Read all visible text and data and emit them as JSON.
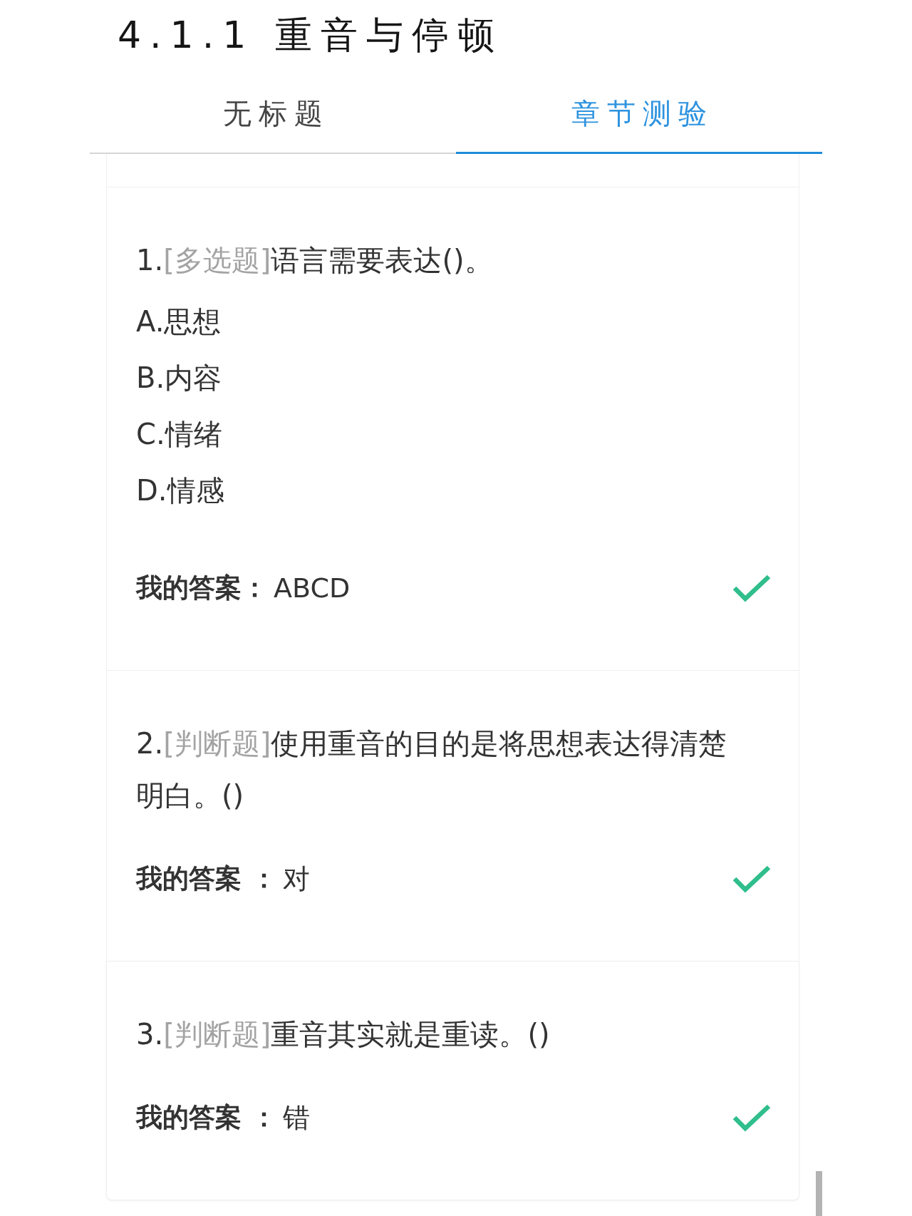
{
  "title": "4.1.1 重音与停顿",
  "tabs": [
    {
      "label": "无标题",
      "selected": false
    },
    {
      "label": "章节测验",
      "selected": true
    }
  ],
  "questions": [
    {
      "number": "1.",
      "type_tag": "[多选题]",
      "text": "语言需要表达()。",
      "options": [
        "A.思想",
        "B.内容",
        "C.情绪",
        "D.情感"
      ],
      "answer_label": "我的答案：",
      "answer": "ABCD",
      "correct": true
    },
    {
      "number": "2.",
      "type_tag": "[判断题]",
      "text": "使用重音的目的是将思想表达得清楚明白。()",
      "answer_label": "我的答案 ：",
      "answer": "对",
      "correct": true
    },
    {
      "number": "3.",
      "type_tag": "[判断题]",
      "text": "重音其实就是重读。()",
      "answer_label": "我的答案 ：",
      "answer": "错",
      "correct": true
    }
  ]
}
